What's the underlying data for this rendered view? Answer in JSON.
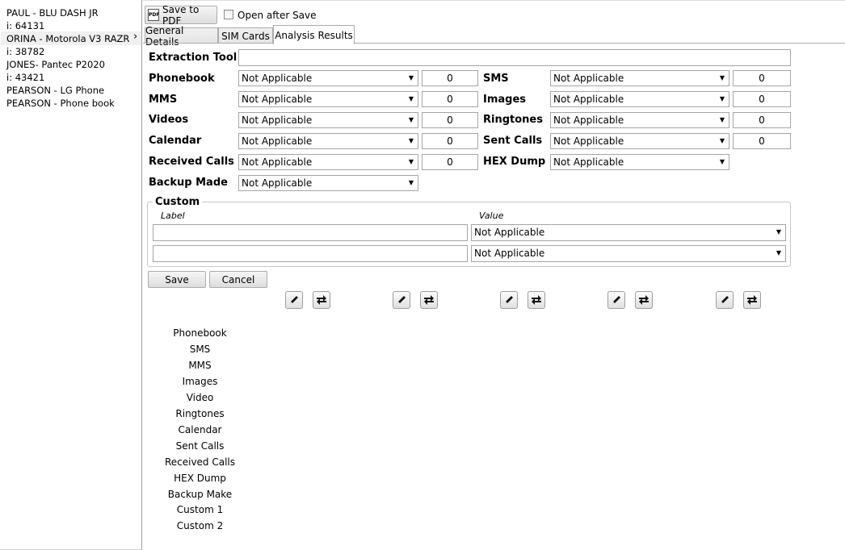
{
  "sidebar": {
    "items": [
      "PAUL - BLU DASH JR",
      "i: 64131",
      "ORINA - Motorola V3 RAZR",
      "i: 38782",
      "JONES- Pantec P2020",
      "i: 43421",
      "PEARSON - LG Phone",
      "PEARSON - Phone book"
    ],
    "chevron": "›"
  },
  "toolbar": {
    "save_pdf_label": "Save to PDF",
    "open_after_save_label": "Open after Save",
    "pdf_icon_text": "PDF"
  },
  "tabs": [
    "General Details",
    "SIM Cards",
    "Analysis Results"
  ],
  "form": {
    "extraction_tool_label": "Extraction Tool",
    "extraction_tool_value": "",
    "left_rows": [
      {
        "label": "Phonebook",
        "value": "Not Applicable",
        "count": "0"
      },
      {
        "label": "MMS",
        "value": "Not Applicable",
        "count": "0"
      },
      {
        "label": "Videos",
        "value": "Not Applicable",
        "count": "0"
      },
      {
        "label": "Calendar",
        "value": "Not Applicable",
        "count": "0"
      },
      {
        "label": "Received Calls",
        "value": "Not Applicable",
        "count": "0"
      },
      {
        "label": "Backup Made",
        "value": "Not Applicable"
      }
    ],
    "right_rows": [
      {
        "label": "SMS",
        "value": "Not Applicable",
        "count": "0"
      },
      {
        "label": "Images",
        "value": "Not Applicable",
        "count": "0"
      },
      {
        "label": "Ringtones",
        "value": "Not Applicable",
        "count": "0"
      },
      {
        "label": "Sent Calls",
        "value": "Not Applicable",
        "count": "0"
      },
      {
        "label": "HEX Dump",
        "value": "Not Applicable"
      }
    ],
    "custom": {
      "title": "Custom",
      "label_header": "Label",
      "value_header": "Value",
      "rows": [
        {
          "label": "",
          "value": "Not Applicable"
        },
        {
          "label": "",
          "value": "Not Applicable"
        }
      ]
    },
    "save_label": "Save",
    "cancel_label": "Cancel"
  },
  "icon_pairs": [
    "edit-icon",
    "swap-icon"
  ],
  "results_list": [
    "Phonebook",
    "SMS",
    "MMS",
    "Images",
    "Video",
    "Ringtones",
    "Calendar",
    "Sent Calls",
    "Received Calls",
    "HEX Dump",
    "Backup Make",
    "Custom 1",
    "Custom 2"
  ]
}
